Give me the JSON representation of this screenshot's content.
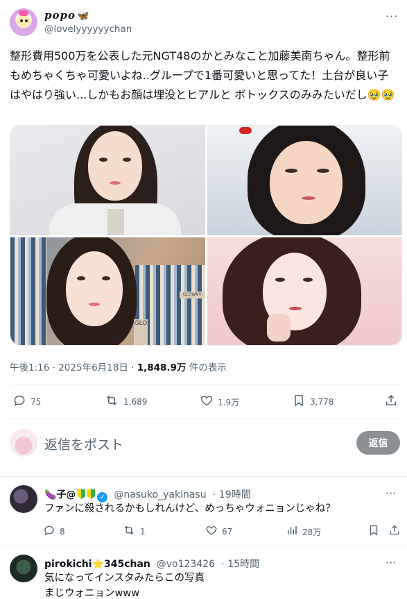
{
  "post": {
    "display_name": "popo",
    "display_name_emoji": "🦋",
    "handle": "@lovelyyyyyychan",
    "text": "整形費用500万を公表した元NGT48のかとみなこと加藤美南ちゃん。整形前もめちゃくちゃ可愛いよね..グループで1番可愛いと思ってた！土台が良い子はやはり強い...しかもお顔は埋没とヒアルと ボトックスのみみたいだし",
    "text_emoji": "🥹🥹",
    "time": "午後1:16",
    "date": "2025年6月18日",
    "views": "1,848.9万",
    "views_label": "件の表示",
    "separator": "·"
  },
  "actions": {
    "replies": "75",
    "reposts": "1,689",
    "likes": "1.9万",
    "bookmarks": "3,778"
  },
  "reply_box": {
    "placeholder": "返信をポスト",
    "button": "返信"
  },
  "comments": [
    {
      "name_prefix": "🍆子@",
      "handle": "@nasuko_yakinasu",
      "time": "19時間",
      "text": "ファンに殺されるかもしれんけど、めっちゃウォニョンじゃね？",
      "replies": "8",
      "reposts": "1",
      "likes": "67",
      "views": "28万"
    },
    {
      "name_prefix": "pirokichi",
      "name_star": "⭐",
      "name_suffix": "345chan",
      "handle": "@vo123426",
      "time": "15時間",
      "text_line1": "気になってインスタみたらこの写真",
      "text_line2": "まじウォニョンwww"
    }
  ],
  "photo_tag": "GLO",
  "photo_tag_small": "GLOWNY",
  "colors": {
    "text_primary": "#0f1419",
    "text_secondary": "#536471",
    "verified": "#1d9bf0",
    "reply_button": "#8b9094"
  },
  "icons": {
    "more": "more-icon",
    "reply": "reply-icon",
    "repost": "repost-icon",
    "like": "heart-icon",
    "bookmark": "bookmark-icon",
    "share": "share-icon",
    "views": "views-icon"
  }
}
